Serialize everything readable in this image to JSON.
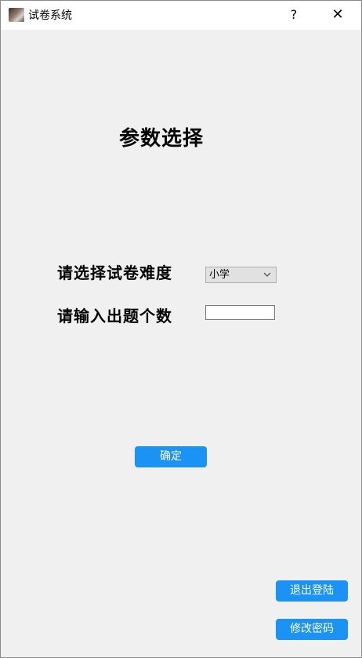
{
  "window": {
    "title": "试卷系统",
    "help_glyph": "?",
    "close_glyph": "✕"
  },
  "page": {
    "title": "参数选择"
  },
  "form": {
    "difficulty_label": "请选择试卷难度",
    "difficulty_selected": "小学",
    "count_label": "请输入出题个数",
    "count_value": ""
  },
  "buttons": {
    "confirm": "确定",
    "logout": "退出登陆",
    "change_password": "修改密码"
  },
  "colors": {
    "accent": "#1a93f4",
    "background": "#f0f0f0",
    "titlebar": "#ffffff"
  },
  "icons": {
    "app": "app-icon",
    "help": "help-icon",
    "close": "close-icon",
    "dropdown": "chevron-down-icon"
  }
}
